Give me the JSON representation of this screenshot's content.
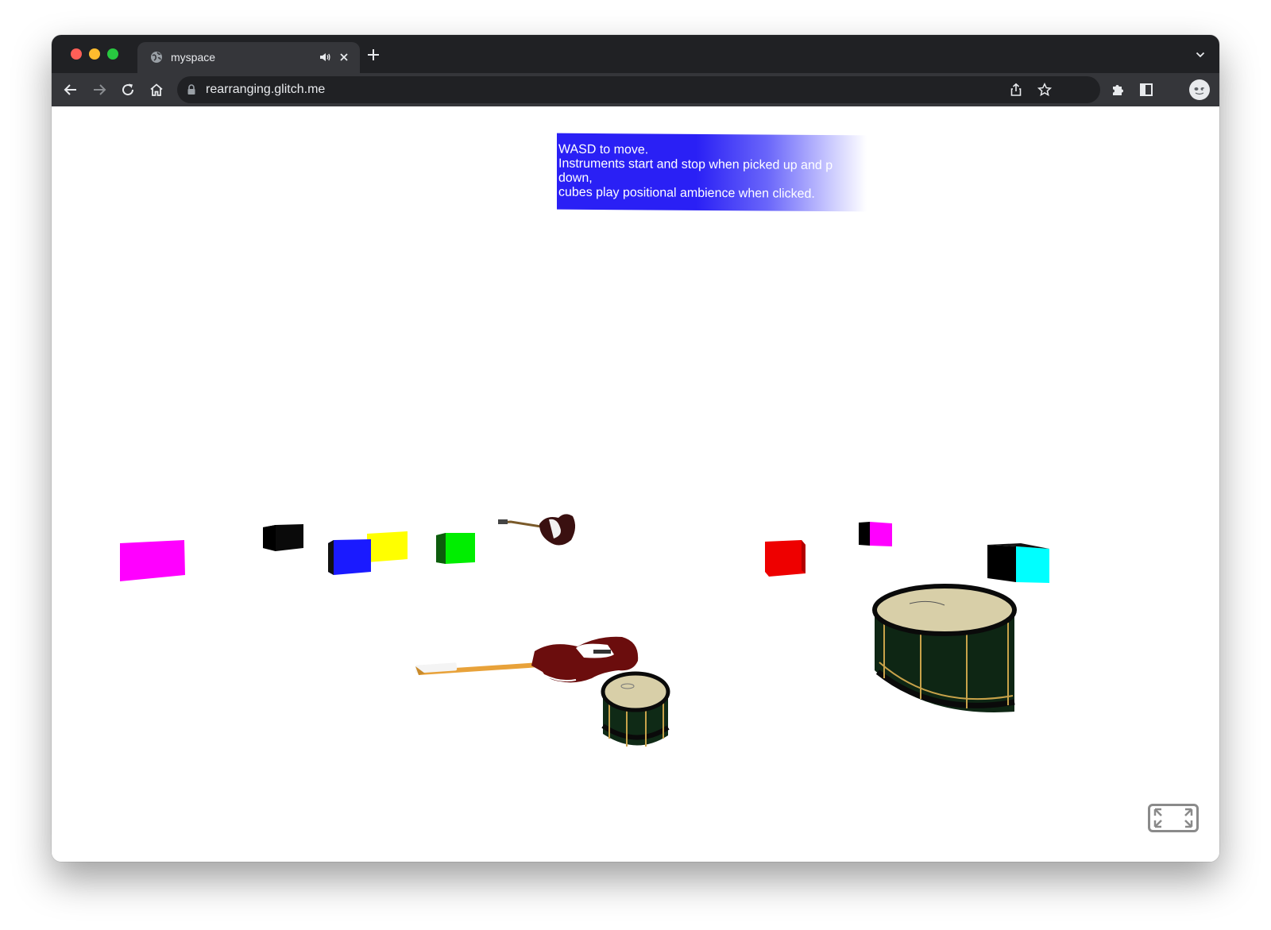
{
  "browser": {
    "tab": {
      "title": "myspace"
    },
    "address_bar": {
      "url": "rearranging.glitch.me"
    },
    "icons": {
      "back": "arrow-left-icon",
      "forward": "arrow-right-icon",
      "reload": "reload-icon",
      "home": "home-icon",
      "lock": "lock-icon",
      "share": "share-icon",
      "bookmark": "star-icon",
      "extensions": "puzzle-icon",
      "sidepanel": "side-panel-icon",
      "menu": "kebab-menu-icon"
    }
  },
  "scene": {
    "instructions": {
      "lines": [
        "WASD to move.",
        "Instruments start and stop when picked up and p",
        "down,",
        "cubes play positional ambience when clicked."
      ]
    },
    "cube_colors": [
      "#ff00ff",
      "#000000",
      "#1a1aff",
      "#ffff00",
      "#00ee00",
      "#ee0000",
      "#ff00ff",
      "#00ffff"
    ],
    "objects": [
      "electric-guitar",
      "electric-guitar",
      "snare-drum",
      "bass-drum"
    ]
  }
}
